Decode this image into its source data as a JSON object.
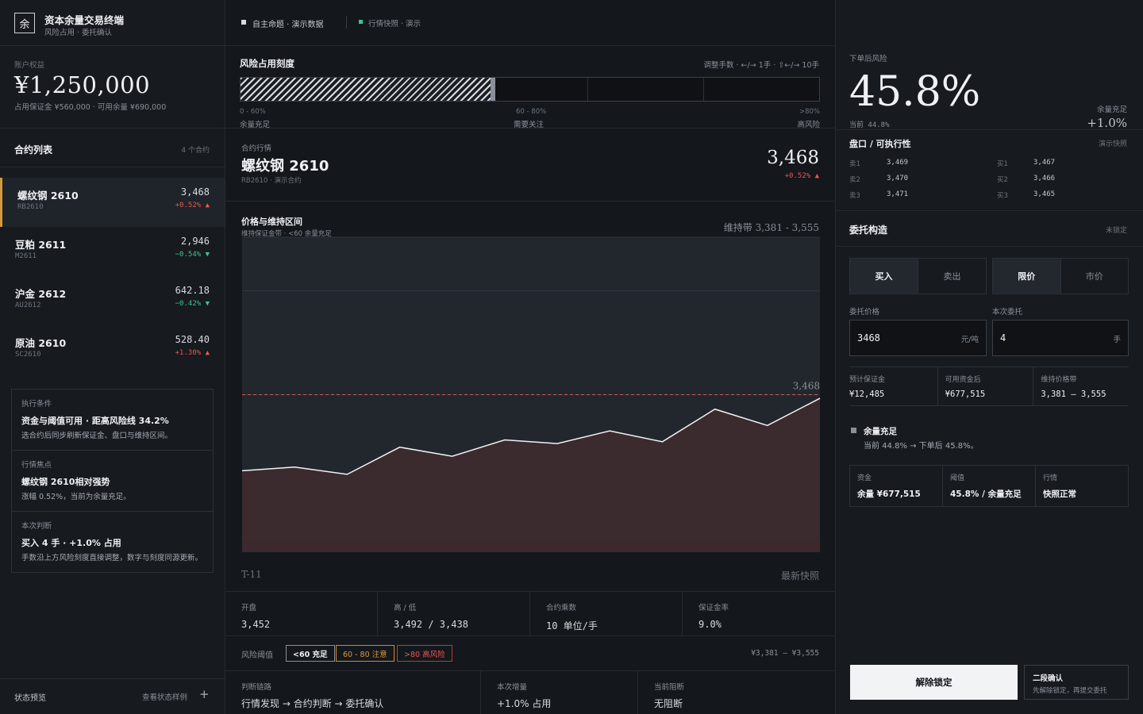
{
  "brand": {
    "logo_char": "余",
    "title": "资本余量交易终端",
    "subtitle": "风险占用 · 委托确认"
  },
  "account": {
    "label": "账户权益",
    "equity": "¥1,250,000",
    "detail": "占用保证金 ¥560,000 · 可用余量 ¥690,000"
  },
  "contracts": {
    "title": "合约列表",
    "count": "4 个合约",
    "items": [
      {
        "name": "螺纹钢 2610",
        "code": "RB2610",
        "price": "3,468",
        "change": "+0.52%",
        "dir": "up"
      },
      {
        "name": "豆粕 2611",
        "code": "M2611",
        "price": "2,946",
        "change": "−0.54%",
        "dir": "down"
      },
      {
        "name": "沪金 2612",
        "code": "AU2612",
        "price": "642.18",
        "change": "−0.42%",
        "dir": "down"
      },
      {
        "name": "原油 2610",
        "code": "SC2610",
        "price": "528.40",
        "change": "+1.30%",
        "dir": "up"
      }
    ]
  },
  "info": {
    "execution": {
      "label": "执行条件",
      "title": "资金与阈值可用 · 距高风险线 34.2%",
      "desc": "选合约后同步刷新保证金、盘口与维持区间。"
    },
    "focus": {
      "label": "行情焦点",
      "title": "螺纹钢 2610相对强势",
      "desc": "涨幅 0.52%，当前为余量充足。"
    },
    "judgement": {
      "label": "本次判断",
      "title": "买入 4 手 · +1.0% 占用",
      "desc": "手数沿上方风险刻度直接调整，数字与刻度同源更新。"
    }
  },
  "footer_left": {
    "label": "状态预览",
    "link": "查看状态样例",
    "plus": "+"
  },
  "topbar": {
    "theme": "自主命题 · 演示数据",
    "feed": "行情快照 · 演示"
  },
  "risk_scale": {
    "title": "风险占用刻度",
    "hint": "调整手数 · ←/→ 1手 · ⇧←/→ 10手",
    "fill_pct": 45.8,
    "zones": [
      {
        "range": "0 - 60%",
        "label": "余量充足"
      },
      {
        "range": "60 - 80%",
        "label": "需要关注"
      },
      {
        "range": ">80%",
        "label": "高风险"
      }
    ]
  },
  "quote": {
    "label": "合约行情",
    "name": "螺纹钢 2610",
    "code": "RB2610 · 演示合约",
    "price": "3,468",
    "change": "+0.52%"
  },
  "chart_data": {
    "type": "area",
    "title": "价格与维持区间",
    "subtitle": "维持保证金带 · <60 余量充足",
    "band_label": "维持带 3,381 - 3,555",
    "ref_label": "3,468",
    "x_start_label": "T-11",
    "x_end_label": "最新快照",
    "ylim": [
      3381,
      3555
    ],
    "reference_value": 3468,
    "values": [
      3426,
      3428,
      3424,
      3439,
      3434,
      3443,
      3441,
      3448,
      3442,
      3460,
      3451,
      3466
    ],
    "grid": true
  },
  "stats": [
    {
      "label": "开盘",
      "value": "3,452"
    },
    {
      "label": "高 / 低",
      "value": "3,492 / 3,438"
    },
    {
      "label": "合约乘数",
      "value": "10 单位/手"
    },
    {
      "label": "保证金率",
      "value": "9.0%"
    }
  ],
  "thresholds": {
    "label": "风险阈值",
    "chips": [
      "<60 充足",
      "60 - 80 注意",
      ">80 高风险"
    ],
    "range": "¥3,381 — ¥3,555"
  },
  "bottom_center": [
    {
      "label": "判断链路",
      "value": "行情发现 → 合约判断 → 委托确认"
    },
    {
      "label": "本次增量",
      "value": "+1.0% 占用"
    },
    {
      "label": "当前阻断",
      "value": "无阻断"
    }
  ],
  "post_risk": {
    "label": "下单后风险",
    "value": "45.8%",
    "current": "当前 44.8%",
    "status_label": "余量充足",
    "delta": "+1.0%"
  },
  "orderbook": {
    "title": "盘口 / 可执行性",
    "tag": "演示快照",
    "asks": [
      {
        "label": "卖1",
        "price": "3,469"
      },
      {
        "label": "卖2",
        "price": "3,470"
      },
      {
        "label": "卖3",
        "price": "3,471"
      }
    ],
    "bids": [
      {
        "label": "买1",
        "price": "3,467"
      },
      {
        "label": "买2",
        "price": "3,466"
      },
      {
        "label": "买3",
        "price": "3,465"
      }
    ]
  },
  "order": {
    "title": "委托构造",
    "lock_state": "未锁定",
    "side_buy": "买入",
    "side_sell": "卖出",
    "type_limit": "限价",
    "type_market": "市价",
    "price_label": "委托价格",
    "price_value": "3468",
    "price_unit": "元/吨",
    "qty_label": "本次委托",
    "qty_value": "4",
    "qty_unit": "手",
    "metrics": [
      {
        "label": "预计保证金",
        "value": "¥12,485"
      },
      {
        "label": "可用资金后",
        "value": "¥677,515"
      },
      {
        "label": "维持价格带",
        "value": "3,381 – 3,555"
      }
    ],
    "status_title": "余量充足",
    "status_desc": "当前 44.8% → 下单后 45.8%。",
    "checks": [
      {
        "label": "资金",
        "value": "余量 ¥677,515"
      },
      {
        "label": "阈值",
        "value": "45.8% / 余量充足"
      },
      {
        "label": "行情",
        "value": "快照正常"
      }
    ],
    "unlock_button": "解除锁定",
    "confirm_title": "二段确认",
    "confirm_desc": "先解除锁定，再提交委托"
  }
}
